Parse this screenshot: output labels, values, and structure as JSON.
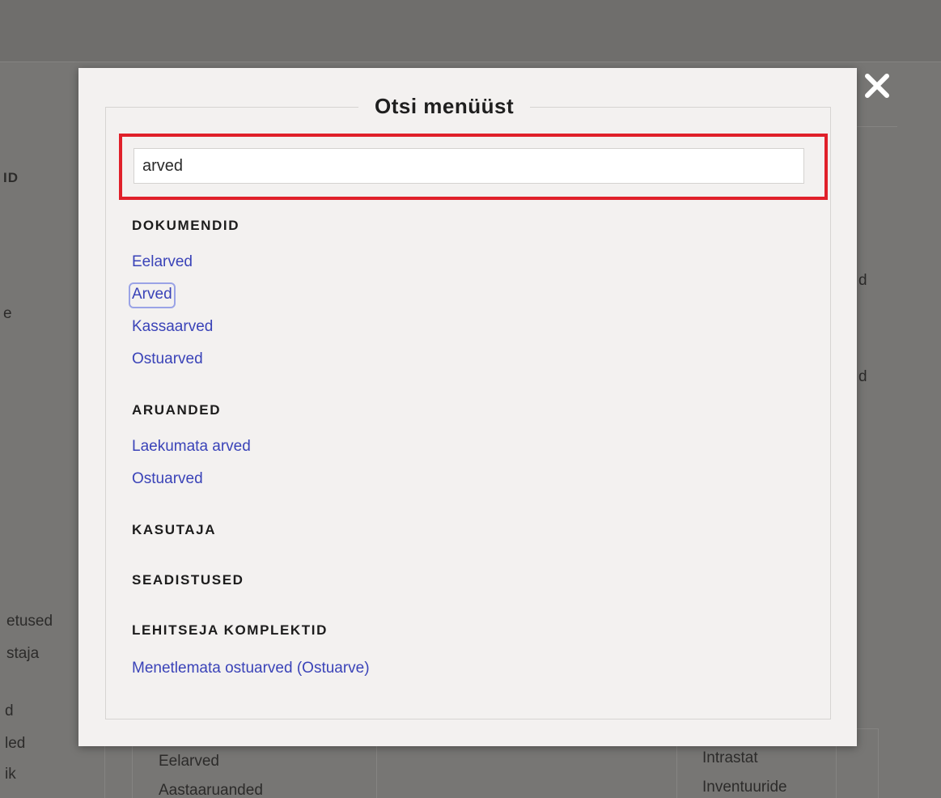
{
  "dialog": {
    "title": "Otsi menüüst",
    "search": {
      "value": "arved",
      "placeholder": ""
    },
    "close_icon": "close-icon",
    "categories": [
      {
        "label": "DOKUMENDID",
        "items": [
          "Eelarved",
          "Arved",
          "Kassaarved",
          "Ostuarved"
        ]
      },
      {
        "label": "ARUANDED",
        "items": [
          "Laekumata arved",
          "Ostuarved"
        ]
      },
      {
        "label": "KASUTAJA",
        "items": []
      },
      {
        "label": "SEADISTUSED",
        "items": []
      },
      {
        "label": "LEHITSEJA KOMPLEKTID",
        "items": [
          "Menetlemata ostuarved (Ostuarve)"
        ]
      }
    ],
    "focused_item": "Arved"
  },
  "background": {
    "left_fragments": [
      "ID",
      "e",
      "etused",
      "staja",
      "d",
      "led",
      "ik"
    ],
    "right_fragments": [
      "d",
      "d"
    ],
    "bottom_left": [
      "Eelarved",
      "Aastaaruanded"
    ],
    "bottom_right": [
      "Intrastat",
      "Inventuuride"
    ]
  },
  "colors": {
    "link": "#3a43b8",
    "highlight": "#e0202a",
    "overlay": "#6f6e6c"
  }
}
